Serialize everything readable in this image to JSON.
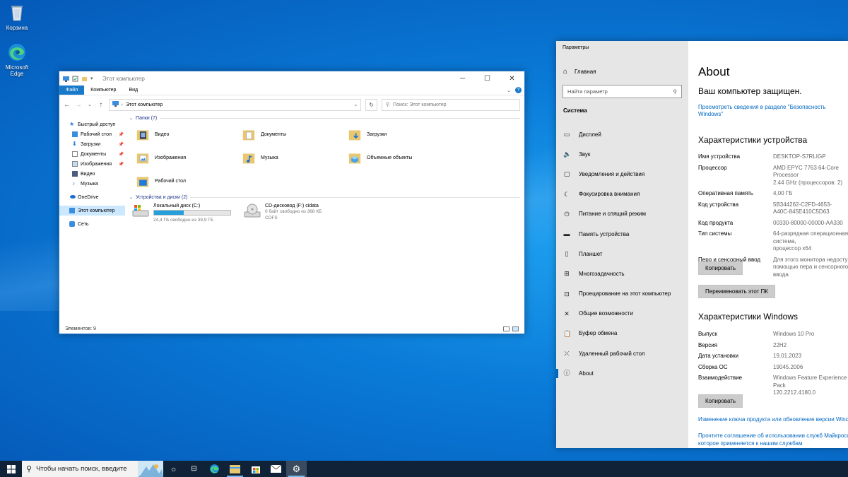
{
  "desktop": {
    "icons": [
      {
        "label": "Корзина"
      },
      {
        "label": "Microsoft Edge"
      }
    ]
  },
  "explorer": {
    "title": "Этот компьютер",
    "ribbon_tabs": [
      "Файл",
      "Компьютер",
      "Вид"
    ],
    "address": "Этот компьютер",
    "search_placeholder": "Поиск: Этот компьютер",
    "nav": [
      {
        "label": "Быстрый доступ"
      },
      {
        "label": "Рабочий стол"
      },
      {
        "label": "Загрузки"
      },
      {
        "label": "Документы"
      },
      {
        "label": "Изображения"
      },
      {
        "label": "Видео"
      },
      {
        "label": "Музыка"
      },
      {
        "label": "OneDrive"
      },
      {
        "label": "Этот компьютер"
      },
      {
        "label": "Сеть"
      }
    ],
    "folders_header": "Папки (7)",
    "folders": [
      "Видео",
      "Документы",
      "Загрузки",
      "Изображения",
      "Музыка",
      "Объемные объекты",
      "Рабочий стол"
    ],
    "drives_header": "Устройства и диски (2)",
    "drives": [
      {
        "name": "Локальный диск (C:)",
        "free": "24,4 ГБ свободно из 39,9 ГБ",
        "used_fraction": 0.39
      },
      {
        "name": "CD-дисковод (F:) cidata",
        "free": "0 байт свободно из 368 КБ",
        "fs": "CDFS"
      }
    ],
    "status": "Элементов: 9"
  },
  "settings": {
    "title": "Параметры",
    "home": "Главная",
    "search_placeholder": "Найти параметр",
    "section": "Система",
    "nav": [
      {
        "label": "Дисплей",
        "icon": "display-icon"
      },
      {
        "label": "Звук",
        "icon": "sound-icon"
      },
      {
        "label": "Уведомления и действия",
        "icon": "notifications-icon"
      },
      {
        "label": "Фокусировка внимания",
        "icon": "focus-icon"
      },
      {
        "label": "Питание и спящий режим",
        "icon": "power-icon"
      },
      {
        "label": "Память устройства",
        "icon": "storage-icon"
      },
      {
        "label": "Планшет",
        "icon": "tablet-icon"
      },
      {
        "label": "Многозадачность",
        "icon": "multitasking-icon"
      },
      {
        "label": "Проецирование на этот компьютер",
        "icon": "projecting-icon"
      },
      {
        "label": "Общие возможности",
        "icon": "shared-icon"
      },
      {
        "label": "Буфер обмена",
        "icon": "clipboard-icon"
      },
      {
        "label": "Удаленный рабочий стол",
        "icon": "remote-desktop-icon"
      },
      {
        "label": "About",
        "icon": "info-icon"
      }
    ],
    "about": {
      "heading": "About",
      "protected": "Ваш компьютер защищен.",
      "security_link": "Просмотреть сведения в разделе \"Безопасность Windows\"",
      "device_specs_heading": "Характеристики устройства",
      "device_specs": [
        {
          "k": "Имя устройства",
          "v": "DESKTOP-S7RLIGP"
        },
        {
          "k": "Процессор",
          "v": "AMD EPYC 7763 64-Core Processor\n2.44 GHz (процессоров: 2)"
        },
        {
          "k": "Оперативная память",
          "v": "4,00 ГБ"
        },
        {
          "k": "Код устройства",
          "v": "5B344262-C2FD-4653-\nA40C-845E410C5D63"
        },
        {
          "k": "Код продукта",
          "v": "00330-80000-00000-AA330"
        },
        {
          "k": "Тип системы",
          "v": "64-разрядная операционная система,\nпроцессор x64"
        },
        {
          "k": "Перо и сенсорный ввод",
          "v": "Для этого монитора недоступен\nпомощью пера и сенсорного ввода"
        }
      ],
      "copy_btn": "Копировать",
      "rename_btn": "Переименовать этот ПК",
      "win_specs_heading": "Характеристики Windows",
      "win_specs": [
        {
          "k": "Выпуск",
          "v": "Windows 10 Pro"
        },
        {
          "k": "Версия",
          "v": "22H2"
        },
        {
          "k": "Дата установки",
          "v": "19.01.2023"
        },
        {
          "k": "Сборка ОС",
          "v": "19045.2006"
        },
        {
          "k": "Взаимодействие",
          "v": "Windows Feature Experience Pack\n120.2212.4180.0"
        }
      ],
      "copy_btn2": "Копировать",
      "link_key": "Изменение ключа продукта или обновление версии Windows",
      "link_agreement_1": "Прочтите соглашение об использовании служб Майкрософт,",
      "link_agreement_2": "которое применяется к нашим службам"
    }
  },
  "taskbar": {
    "search_placeholder": "Чтобы начать поиск, введите"
  },
  "colors": {
    "accent": "#0067c0",
    "taskbar": "#0f2237",
    "file_tab": "#1979ca",
    "drive_fill": "#26a0da"
  }
}
